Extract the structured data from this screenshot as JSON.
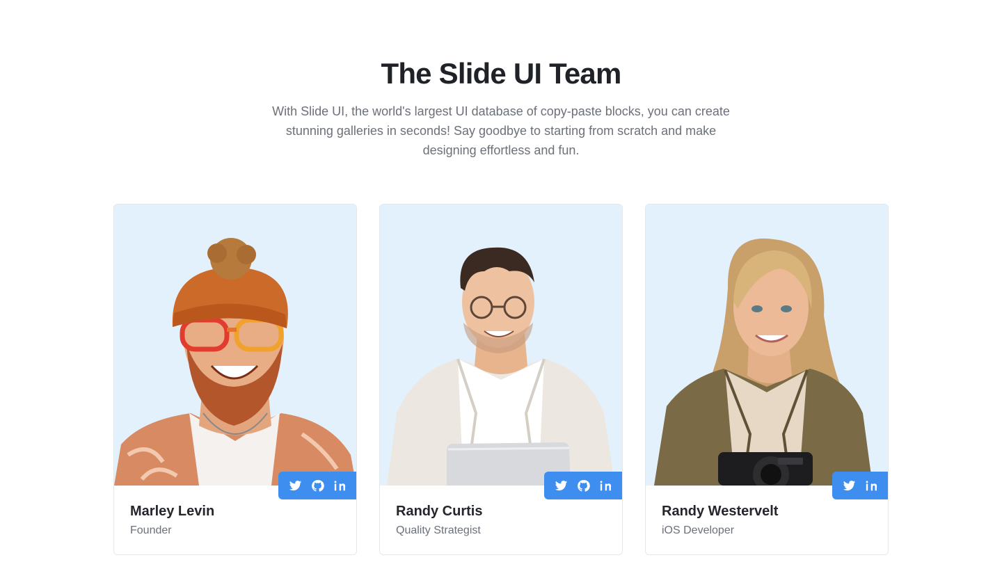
{
  "section": {
    "title": "The Slide UI Team",
    "subtitle": "With Slide UI, the world's largest UI database of copy-paste blocks, you can create stunning galleries in seconds! Say goodbye to starting from scratch and make designing effortless and fun."
  },
  "team": [
    {
      "name": "Marley Levin",
      "role": "Founder",
      "socials": [
        "twitter-icon",
        "github-icon",
        "linkedin-icon"
      ]
    },
    {
      "name": "Randy Curtis",
      "role": "Quality Strategist",
      "socials": [
        "twitter-icon",
        "github-icon",
        "linkedin-icon"
      ]
    },
    {
      "name": "Randy Westervelt",
      "role": "iOS Developer",
      "socials": [
        "twitter-icon",
        "linkedin-icon"
      ]
    }
  ],
  "colors": {
    "accent": "#3e8ef0",
    "photo_background": "#e3f1fd",
    "title": "#1f2227",
    "muted_text": "#6c7079"
  }
}
